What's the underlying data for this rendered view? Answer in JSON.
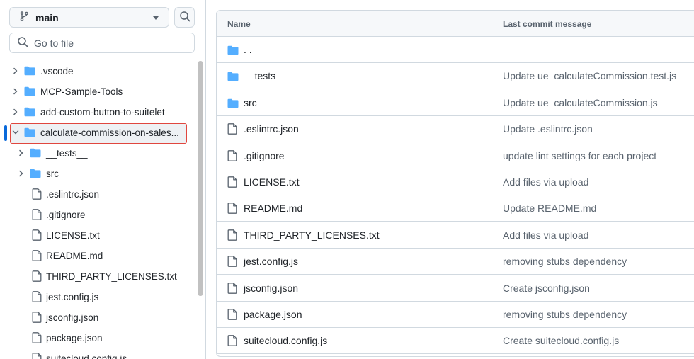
{
  "branch": {
    "name": "main"
  },
  "goto": {
    "placeholder": "Go to file"
  },
  "tree": {
    "items": [
      {
        "label": ".vscode",
        "type": "folder",
        "level": 0,
        "expanded": false
      },
      {
        "label": "MCP-Sample-Tools",
        "type": "folder",
        "level": 0,
        "expanded": false
      },
      {
        "label": "add-custom-button-to-suitelet",
        "type": "folder",
        "level": 0,
        "expanded": false
      },
      {
        "label": "calculate-commission-on-sales...",
        "type": "folder",
        "level": 0,
        "expanded": true,
        "selected": true
      },
      {
        "label": "__tests__",
        "type": "folder",
        "level": 1,
        "expanded": false
      },
      {
        "label": "src",
        "type": "folder",
        "level": 1,
        "expanded": false
      },
      {
        "label": ".eslintrc.json",
        "type": "file",
        "level": 1
      },
      {
        "label": ".gitignore",
        "type": "file",
        "level": 1
      },
      {
        "label": "LICENSE.txt",
        "type": "file",
        "level": 1
      },
      {
        "label": "README.md",
        "type": "file",
        "level": 1
      },
      {
        "label": "THIRD_PARTY_LICENSES.txt",
        "type": "file",
        "level": 1
      },
      {
        "label": "jest.config.js",
        "type": "file",
        "level": 1
      },
      {
        "label": "jsconfig.json",
        "type": "file",
        "level": 1
      },
      {
        "label": "package.json",
        "type": "file",
        "level": 1
      },
      {
        "label": "suitecloud.config.js",
        "type": "file",
        "level": 1
      }
    ]
  },
  "table": {
    "headers": {
      "name": "Name",
      "message": "Last commit message"
    },
    "rows": [
      {
        "name": ". .",
        "type": "folder",
        "message": ""
      },
      {
        "name": "__tests__",
        "type": "folder",
        "message": "Update ue_calculateCommission.test.js"
      },
      {
        "name": "src",
        "type": "folder",
        "message": "Update ue_calculateCommission.js"
      },
      {
        "name": ".eslintrc.json",
        "type": "file",
        "message": "Update .eslintrc.json"
      },
      {
        "name": ".gitignore",
        "type": "file",
        "message": "update lint settings for each project"
      },
      {
        "name": "LICENSE.txt",
        "type": "file",
        "message": "Add files via upload"
      },
      {
        "name": "README.md",
        "type": "file",
        "message": "Update README.md"
      },
      {
        "name": "THIRD_PARTY_LICENSES.txt",
        "type": "file",
        "message": "Add files via upload"
      },
      {
        "name": "jest.config.js",
        "type": "file",
        "message": "removing stubs dependency"
      },
      {
        "name": "jsconfig.json",
        "type": "file",
        "message": "Create jsconfig.json"
      },
      {
        "name": "package.json",
        "type": "file",
        "message": "removing stubs dependency"
      },
      {
        "name": "suitecloud.config.js",
        "type": "file",
        "message": "Create suitecloud.config.js"
      }
    ]
  },
  "colors": {
    "folder": "#54aeff",
    "accent": "#0969da",
    "selection_outline": "#e0473f"
  },
  "icons": {
    "branch": "git-branch-icon",
    "search": "search-icon",
    "folder": "folder-icon",
    "file": "file-icon"
  }
}
